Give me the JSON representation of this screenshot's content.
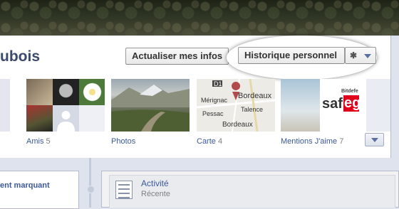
{
  "profile": {
    "name_partial": "ubois"
  },
  "header_buttons": {
    "update_info": "Actualiser mes infos",
    "activity_log": "Historique personnel",
    "settings_icon": "gear-icon",
    "dropdown_icon": "caret-down-icon"
  },
  "sections": [
    {
      "label": "Amis",
      "count": "5"
    },
    {
      "label": "Photos",
      "count": ""
    },
    {
      "label": "Carte",
      "count": "4"
    },
    {
      "label": "Mentions J'aime",
      "count": "7"
    }
  ],
  "map": {
    "road": "D1",
    "labels": [
      "Mérignac",
      "Pessac",
      "Talence",
      "Bordeaux",
      "Bordeaux"
    ]
  },
  "likes_thumb": {
    "brand_top": "Bitdefe",
    "brand_main": "saf",
    "brand_accent": "eg"
  },
  "timeline": {
    "left_card": "ent marquant",
    "activity_title": "Activité",
    "activity_subtitle": "Récente"
  },
  "colors": {
    "link": "#3b5998",
    "count": "#808080",
    "timeline_bg": "#dfe3ee",
    "likes_brand": "#e0001b"
  }
}
